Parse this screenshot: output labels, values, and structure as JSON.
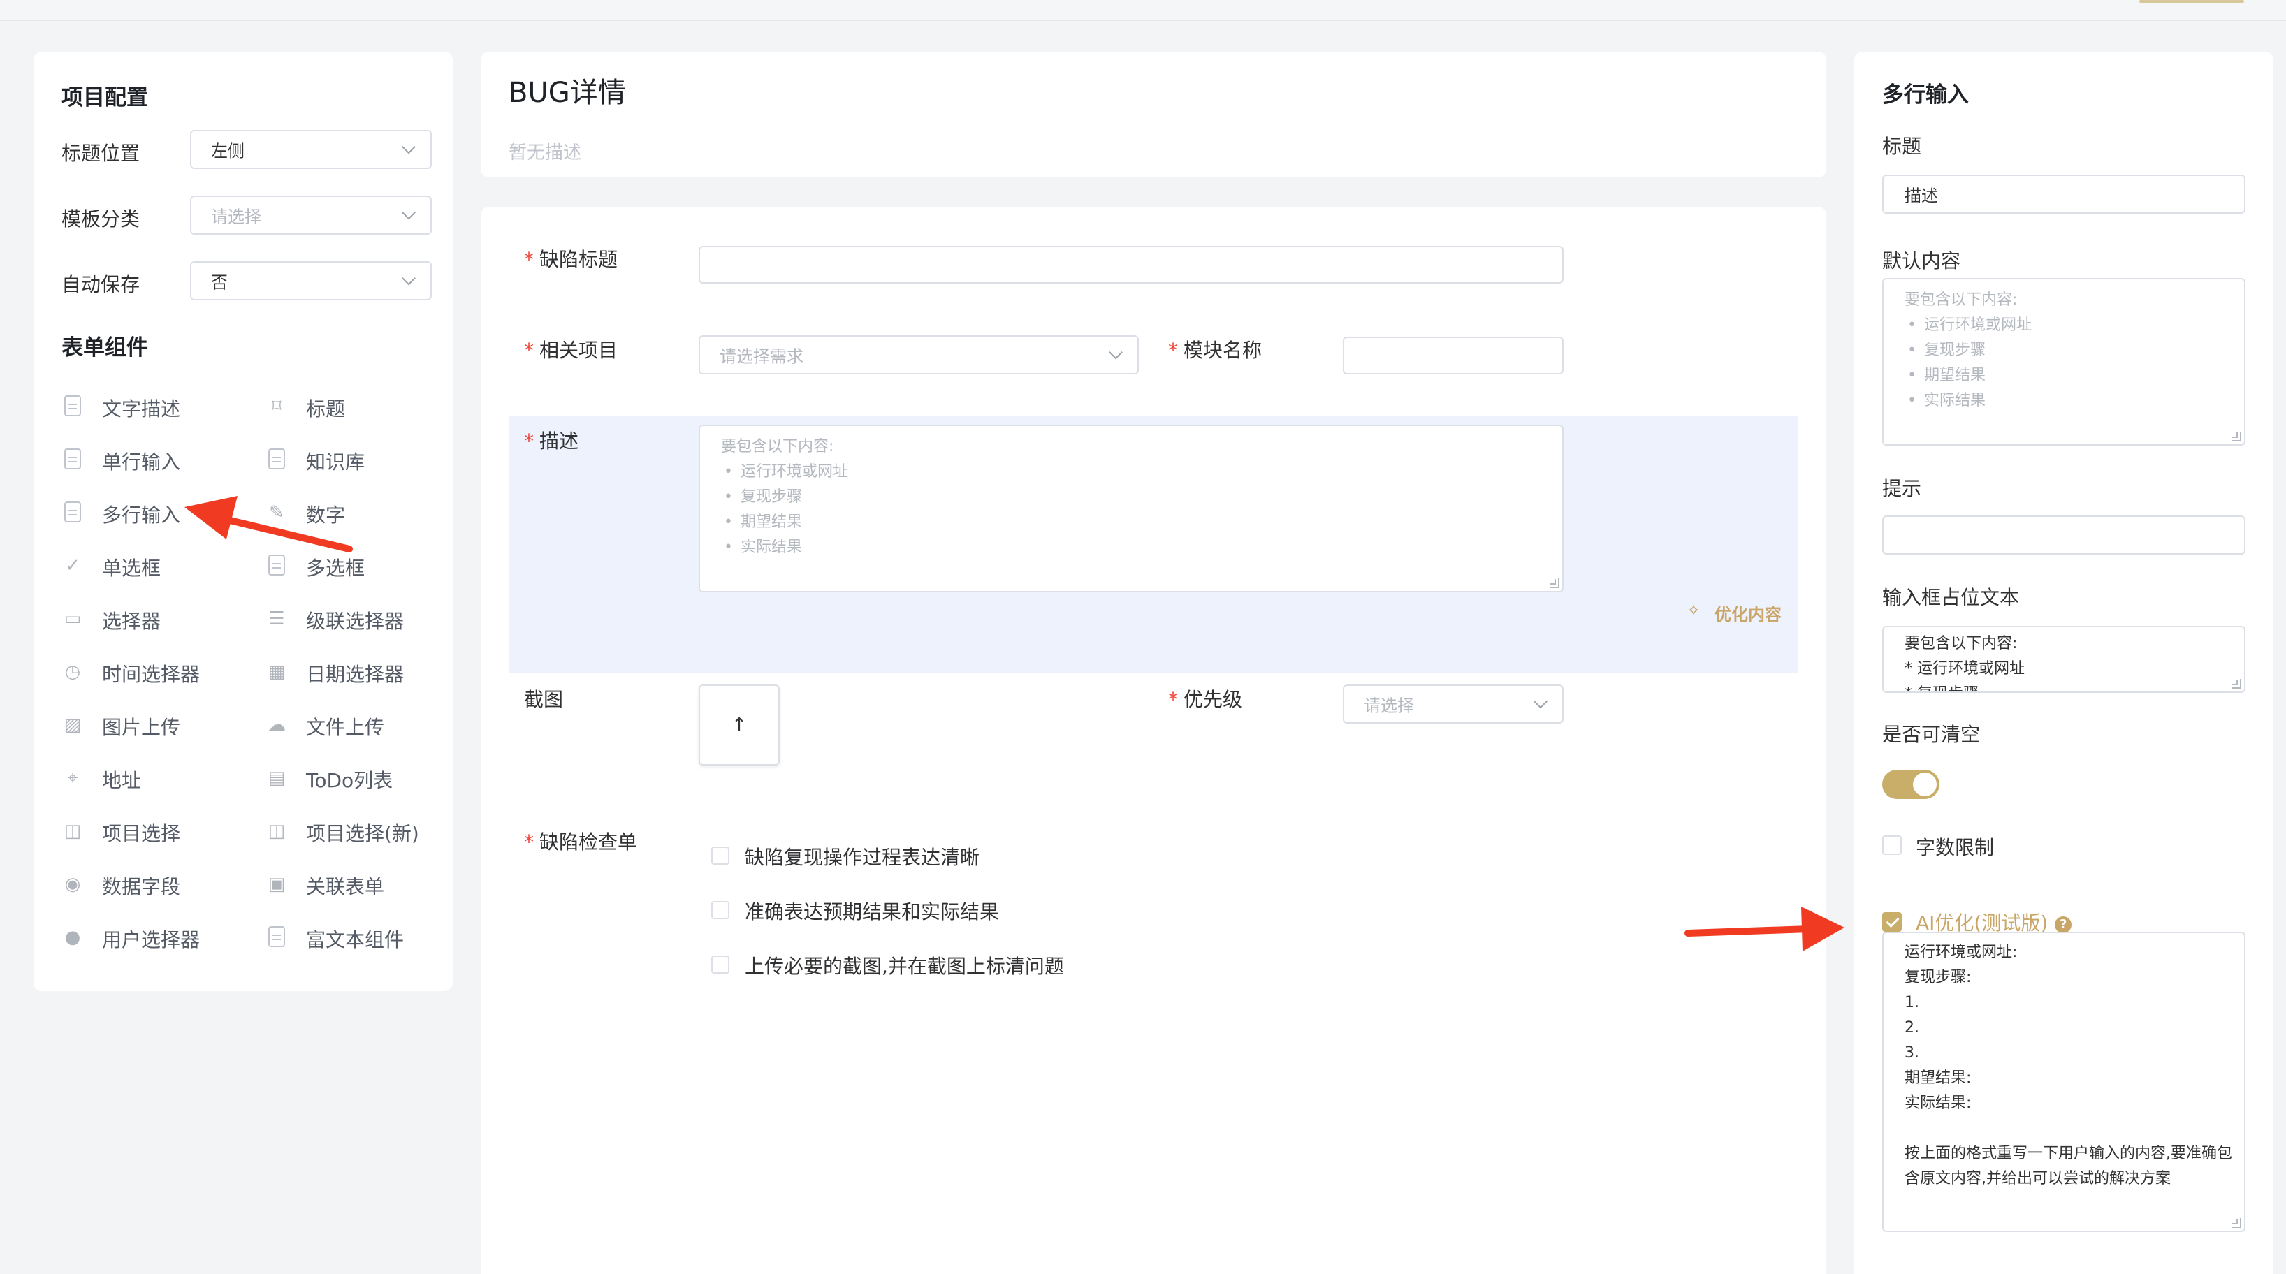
{
  "left": {
    "project_config_title": "项目配置",
    "title_position": {
      "label": "标题位置",
      "value": "左侧"
    },
    "template_category": {
      "label": "模板分类",
      "placeholder": "请选择"
    },
    "auto_save": {
      "label": "自动保存",
      "value": "否"
    },
    "form_components_title": "表单组件",
    "components": [
      {
        "label": "文字描述",
        "icon": "text-doc-icon"
      },
      {
        "label": "标题",
        "icon": "bookmark-icon"
      },
      {
        "label": "单行输入",
        "icon": "single-line-doc-icon"
      },
      {
        "label": "知识库",
        "icon": "knowledge-doc-icon"
      },
      {
        "label": "多行输入",
        "icon": "multi-line-doc-icon"
      },
      {
        "label": "数字",
        "icon": "pencil-icon"
      },
      {
        "label": "单选框",
        "icon": "check-icon"
      },
      {
        "label": "多选框",
        "icon": "checkbox-doc-icon"
      },
      {
        "label": "选择器",
        "icon": "select-box-icon"
      },
      {
        "label": "级联选择器",
        "icon": "list-lines-icon"
      },
      {
        "label": "时间选择器",
        "icon": "clock-icon"
      },
      {
        "label": "日期选择器",
        "icon": "calendar-icon"
      },
      {
        "label": "图片上传",
        "icon": "image-icon"
      },
      {
        "label": "文件上传",
        "icon": "cloud-upload-icon"
      },
      {
        "label": "地址",
        "icon": "location-icon"
      },
      {
        "label": "ToDo列表",
        "icon": "clipboard-icon"
      },
      {
        "label": "项目选择",
        "icon": "columns-icon"
      },
      {
        "label": "项目选择(新)",
        "icon": "columns-icon"
      },
      {
        "label": "数据字段",
        "icon": "eye-icon"
      },
      {
        "label": "关联表单",
        "icon": "linked-form-icon"
      },
      {
        "label": "用户选择器",
        "icon": "user-icon"
      },
      {
        "label": "富文本组件",
        "icon": "rich-text-doc-icon"
      }
    ]
  },
  "header": {
    "title": "BUG详情",
    "description": "暂无描述"
  },
  "form": {
    "defect_title": {
      "label": "缺陷标题"
    },
    "related_project": {
      "label": "相关项目",
      "placeholder": "请选择需求"
    },
    "module_name": {
      "label": "模块名称"
    },
    "description": {
      "label": "描述",
      "placeholder_intro": "要包含以下内容:",
      "placeholder_items": [
        "运行环境或网址",
        "复现步骤",
        "期望结果",
        "实际结果"
      ],
      "optimize_label": "优化内容"
    },
    "screenshot": {
      "label": "截图",
      "upload_icon": "↑"
    },
    "priority": {
      "label": "优先级",
      "placeholder": "请选择"
    },
    "checklist": {
      "label": "缺陷检查单",
      "items": [
        "缺陷复现操作过程表达清晰",
        "准确表达预期结果和实际结果",
        "上传必要的截图,并在截图上标清问题"
      ]
    }
  },
  "right": {
    "title": "多行输入",
    "field_title": {
      "label": "标题",
      "value": "描述"
    },
    "default_content": {
      "label": "默认内容",
      "intro": "要包含以下内容:",
      "items": [
        "运行环境或网址",
        "复现步骤",
        "期望结果",
        "实际结果"
      ]
    },
    "hint": {
      "label": "提示"
    },
    "placeholder_text": {
      "label": "输入框占位文本",
      "line1": "要包含以下内容:",
      "line2": "* 运行环境或网址",
      "line3": "* 复现步骤"
    },
    "clearable": {
      "label": "是否可清空",
      "on": true
    },
    "char_limit": {
      "label": "字数限制",
      "checked": false
    },
    "ai_optimize": {
      "label": "AI优化(测试版)",
      "checked": true,
      "help_icon": "?",
      "prompt": "运行环境或网址:\n复现步骤:\n1.\n2.\n3.\n期望结果:\n实际结果:\n\n按上面的格式重写一下用户输入的内容,要准确包含原文内容,并给出可以尝试的解决方案"
    }
  },
  "colors": {
    "accent_gold": "#c9ae6a",
    "required_red": "#f0453a",
    "annotation_arrow": "#f03a22",
    "highlight_bg": "#edf2fc"
  }
}
